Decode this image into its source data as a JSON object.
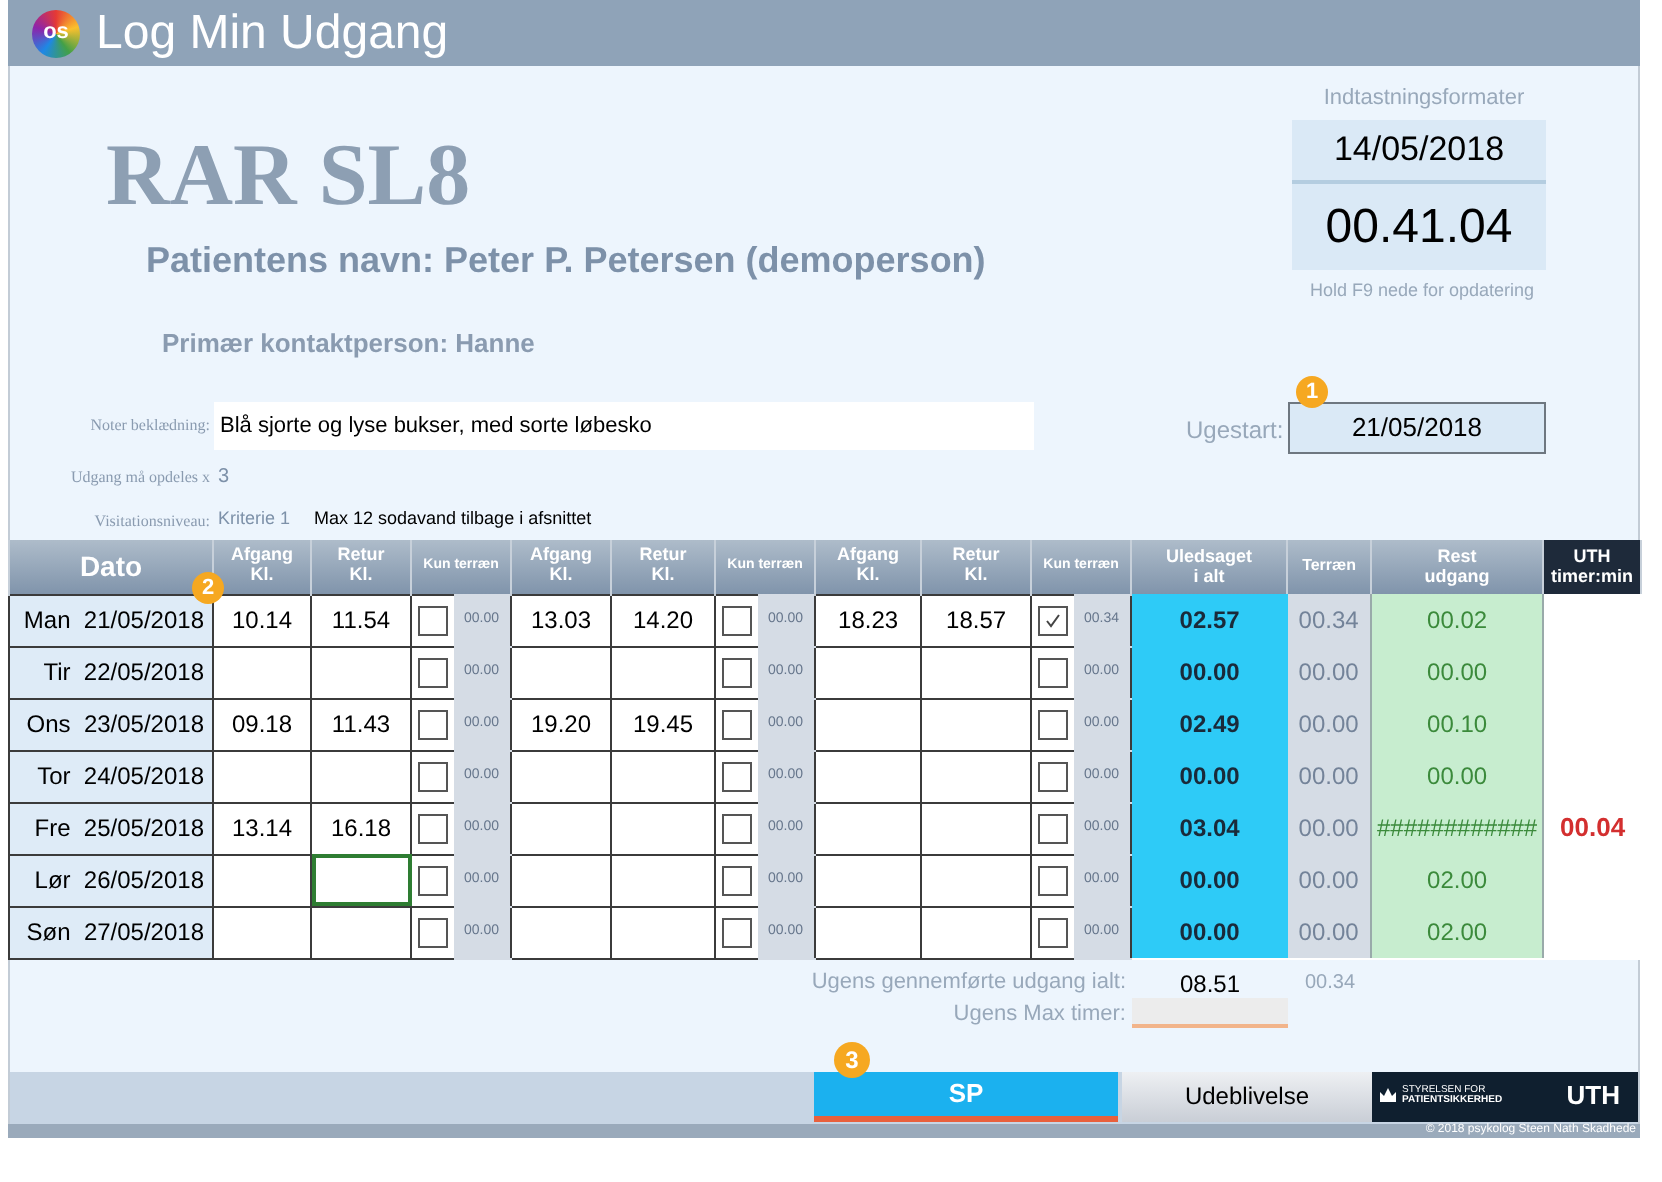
{
  "window": {
    "title": "Log Min Udgang",
    "logo": "os"
  },
  "header": {
    "title": "RAR SL8",
    "patient": "Patientens navn: Peter P. Petersen (demoperson)",
    "contact": "Primær kontaktperson: Hanne"
  },
  "formats": {
    "title": "Indtastningsformater",
    "date": "14/05/2018",
    "time": "00.41.04",
    "hint": "Hold F9 nede for opdatering"
  },
  "notes": {
    "label": "Noter beklædning:",
    "value": "Blå sjorte og lyse bukser, med sorte løbesko"
  },
  "split": {
    "label": "Udgang må opdeles x",
    "value": "3"
  },
  "visitation": {
    "label": "Visitationsniveau:",
    "level": "Kriterie 1",
    "note": "Max 12 sodavand tilbage i afsnittet"
  },
  "ugestart": {
    "label": "Ugestart:",
    "value": "21/05/2018",
    "marker": "1"
  },
  "table": {
    "marker": "2",
    "columns": {
      "date": "Dato",
      "segments": [
        {
          "afgang": [
            "Afgang",
            "Kl."
          ],
          "retur": [
            "Retur",
            "Kl."
          ],
          "kun": "Kun terræn"
        },
        {
          "afgang": [
            "Afgang",
            "Kl."
          ],
          "retur": [
            "Retur",
            "Kl."
          ],
          "kun": "Kun terræn"
        },
        {
          "afgang": [
            "Afgang",
            "Kl."
          ],
          "retur": [
            "Retur",
            "Kl."
          ],
          "kun": "Kun terræn"
        }
      ],
      "uledsaget": [
        "Uledsaget",
        "i alt"
      ],
      "terraen": "Terræn",
      "rest": [
        "Rest",
        "udgang"
      ],
      "uth": [
        "UTH",
        "timer:min"
      ]
    },
    "rows": [
      {
        "day": "Man",
        "date": "21/05/2018",
        "segments": [
          {
            "afgang": "10.14",
            "retur": "11.54",
            "checked": false,
            "terrain": "00.00",
            "retur_selected": false
          },
          {
            "afgang": "13.03",
            "retur": "14.20",
            "checked": false,
            "terrain": "00.00",
            "retur_selected": false
          },
          {
            "afgang": "18.23",
            "retur": "18.57",
            "checked": true,
            "terrain": "00.34",
            "retur_selected": false
          }
        ],
        "uledsaget": "02.57",
        "terraen": "00.34",
        "rest": "00.02"
      },
      {
        "day": "Tir",
        "date": "22/05/2018",
        "segments": [
          {
            "checked": false,
            "terrain": "00.00",
            "retur_selected": false
          },
          {
            "checked": false,
            "terrain": "00.00",
            "retur_selected": false
          },
          {
            "checked": false,
            "terrain": "00.00",
            "retur_selected": false
          }
        ],
        "uledsaget": "00.00",
        "terraen": "00.00",
        "rest": "00.00"
      },
      {
        "day": "Ons",
        "date": "23/05/2018",
        "segments": [
          {
            "afgang": "09.18",
            "retur": "11.43",
            "checked": false,
            "terrain": "00.00",
            "retur_selected": false
          },
          {
            "afgang": "19.20",
            "retur": "19.45",
            "checked": false,
            "terrain": "00.00",
            "retur_selected": false
          },
          {
            "checked": false,
            "terrain": "00.00",
            "retur_selected": false
          }
        ],
        "uledsaget": "02.49",
        "terraen": "00.00",
        "rest": "00.10"
      },
      {
        "day": "Tor",
        "date": "24/05/2018",
        "segments": [
          {
            "checked": false,
            "terrain": "00.00",
            "retur_selected": false
          },
          {
            "checked": false,
            "terrain": "00.00",
            "retur_selected": false
          },
          {
            "checked": false,
            "terrain": "00.00",
            "retur_selected": false
          }
        ],
        "uledsaget": "00.00",
        "terraen": "00.00",
        "rest": "00.00"
      },
      {
        "day": "Fre",
        "date": "25/05/2018",
        "segments": [
          {
            "afgang": "13.14",
            "retur": "16.18",
            "checked": false,
            "terrain": "00.00",
            "retur_selected": false
          },
          {
            "checked": false,
            "terrain": "00.00",
            "retur_selected": false
          },
          {
            "checked": false,
            "terrain": "00.00",
            "retur_selected": false
          }
        ],
        "uledsaget": "03.04",
        "terraen": "00.00",
        "rest": "############",
        "uth": "00.04"
      },
      {
        "day": "Lør",
        "date": "26/05/2018",
        "segments": [
          {
            "checked": false,
            "terrain": "00.00",
            "retur_selected": true
          },
          {
            "checked": false,
            "terrain": "00.00",
            "retur_selected": false
          },
          {
            "checked": false,
            "terrain": "00.00",
            "retur_selected": false
          }
        ],
        "uledsaget": "00.00",
        "terraen": "00.00",
        "rest": "02.00"
      },
      {
        "day": "Søn",
        "date": "27/05/2018",
        "segments": [
          {
            "checked": false,
            "terrain": "00.00",
            "retur_selected": false
          },
          {
            "checked": false,
            "terrain": "00.00",
            "retur_selected": false
          },
          {
            "checked": false,
            "terrain": "00.00",
            "retur_selected": false
          }
        ],
        "uledsaget": "00.00",
        "terraen": "00.00",
        "rest": "02.00"
      }
    ]
  },
  "totals": {
    "label": "Ugens gennemførte udgang ialt:",
    "value": "08.51",
    "terrain": "00.34",
    "max_label": "Ugens Max timer:"
  },
  "buttons": [
    {
      "label": "SP",
      "marker": "3"
    },
    {
      "label": "Udeblivelse"
    }
  ],
  "agency": {
    "line1": "STYRELSEN FOR",
    "line2": "PATIENTSIKKERHED",
    "code": "UTH"
  },
  "copyright": "© 2018 psykolog Steen Nath Skadhede"
}
